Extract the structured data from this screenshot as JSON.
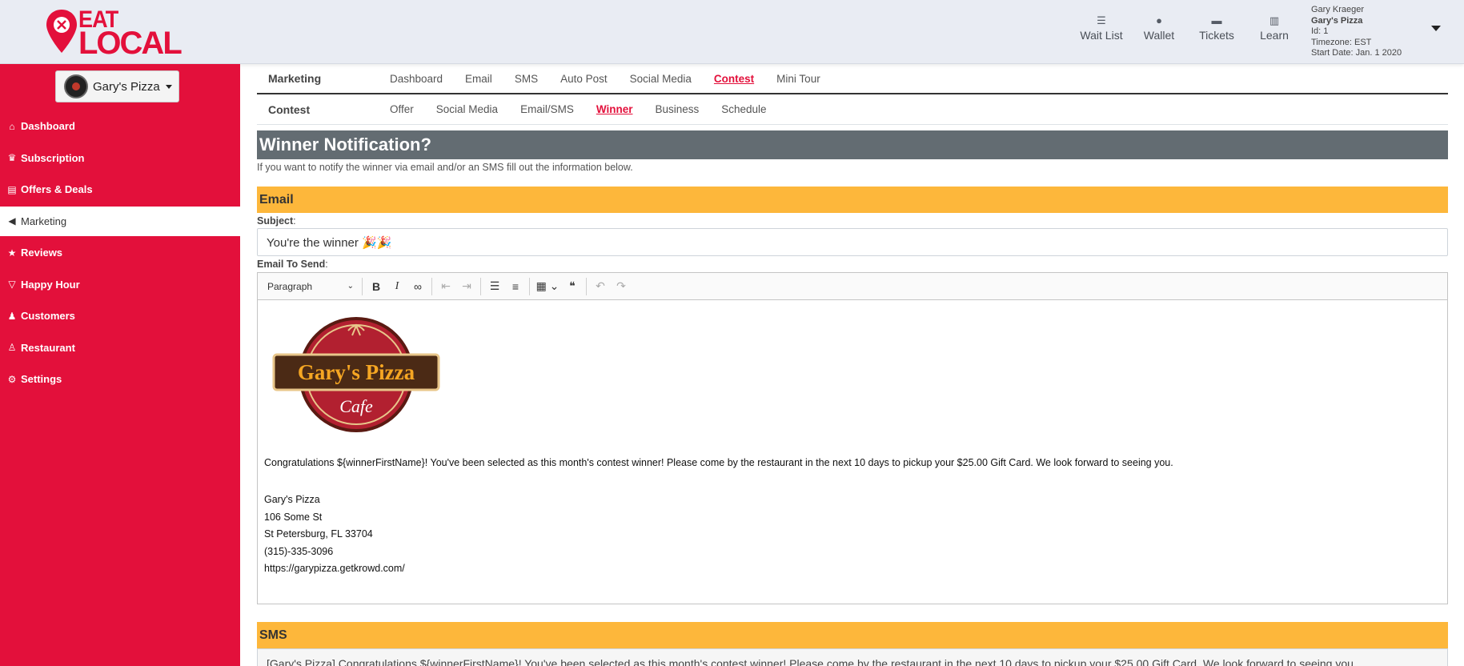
{
  "brand": {
    "line1": "EAT",
    "line2": "LOCAL",
    "color": "#e3103b"
  },
  "topnav": [
    {
      "label": "Wait List",
      "icon": "list-icon"
    },
    {
      "label": "Wallet",
      "icon": "money-bag-icon"
    },
    {
      "label": "Tickets",
      "icon": "ticket-icon"
    },
    {
      "label": "Learn",
      "icon": "library-icon"
    }
  ],
  "user": {
    "name": "Gary Kraeger",
    "business": "Gary's Pizza",
    "id": "Id: 1",
    "timezone": "Timezone: EST",
    "start_date": "Start Date: Jan. 1 2020"
  },
  "sidebar": {
    "business_selector": "Gary's Pizza",
    "items": [
      {
        "label": "Dashboard",
        "icon": "home-icon"
      },
      {
        "label": "Subscription",
        "icon": "crown-icon"
      },
      {
        "label": "Offers & Deals",
        "icon": "file-icon"
      },
      {
        "label": "Marketing",
        "icon": "megaphone-icon",
        "active": true
      },
      {
        "label": "Reviews",
        "icon": "star-icon"
      },
      {
        "label": "Happy Hour",
        "icon": "cocktail-icon"
      },
      {
        "label": "Customers",
        "icon": "users-icon"
      },
      {
        "label": "Restaurant",
        "icon": "chef-icon"
      },
      {
        "label": "Settings",
        "icon": "gear-icon"
      }
    ]
  },
  "marketing_tabs": {
    "label": "Marketing",
    "items": [
      "Dashboard",
      "Email",
      "SMS",
      "Auto Post",
      "Social Media",
      "Contest",
      "Mini Tour"
    ],
    "active": "Contest"
  },
  "contest_tabs": {
    "label": "Contest",
    "items": [
      "Offer",
      "Social Media",
      "Email/SMS",
      "Winner",
      "Business",
      "Schedule"
    ],
    "active": "Winner"
  },
  "page": {
    "title": "Winner Notification?",
    "hint": "If you want to notify the winner via email and/or an SMS fill out the information below."
  },
  "email": {
    "heading": "Email",
    "subject_label": "Subject",
    "subject_value": "You're the winner 🎉🎉",
    "body_label": "Email To Send",
    "toolbar": {
      "paragraph": "Paragraph"
    },
    "logo": {
      "line1": "Gary's Pizza",
      "line2": "Cafe"
    },
    "congrats": "Congratulations ${winnerFirstName}! You've been selected as this month's contest winner! Please come by the restaurant in the next 10 days to pickup your $25.00 Gift Card. We look forward to seeing you.",
    "signature": {
      "name": "Gary's Pizza",
      "street": "106 Some St",
      "city": "St Petersburg, FL 33704",
      "phone": "(315)-335-3096",
      "url": "https://garypizza.getkrowd.com/"
    }
  },
  "sms": {
    "heading": "SMS",
    "value": "[Gary's Pizza] Congratulations ${winnerFirstName}! You've been selected as this month's contest winner! Please come by the restaurant in the next 10 days to pickup your $25.00 Gift Card. We look forward to seeing you"
  },
  "colors": {
    "accent": "#e3103b",
    "section_orange": "#fdb73b",
    "section_dark": "#636c72"
  }
}
